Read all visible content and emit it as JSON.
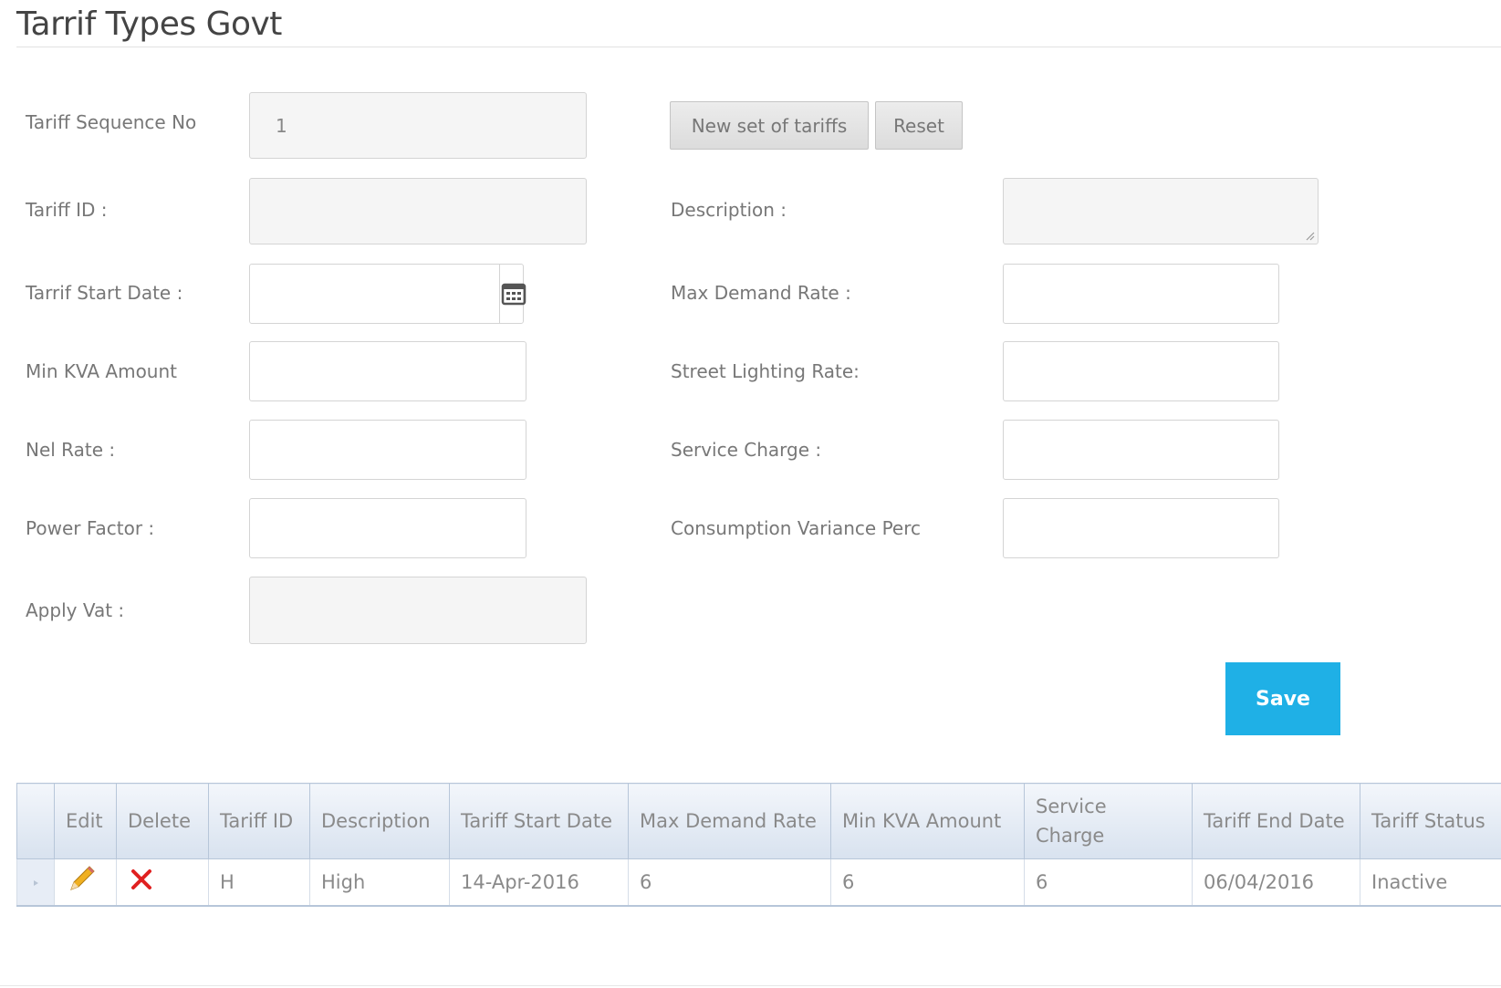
{
  "page": {
    "title": "Tarrif Types Govt"
  },
  "form": {
    "tariff_sequence_no": {
      "label": "Tariff Sequence No",
      "value": "1"
    },
    "tariff_id": {
      "label": "Tariff ID :",
      "value": ""
    },
    "tariff_start_date": {
      "label": "Tarrif Start Date :",
      "value": ""
    },
    "min_kva_amount": {
      "label": "Min KVA Amount",
      "value": ""
    },
    "nel_rate": {
      "label": "Nel Rate :",
      "value": ""
    },
    "power_factor": {
      "label": "Power Factor :",
      "value": ""
    },
    "apply_vat": {
      "label": "Apply Vat :",
      "value": ""
    },
    "description": {
      "label": "Description :",
      "value": ""
    },
    "max_demand_rate": {
      "label": "Max Demand Rate :",
      "value": ""
    },
    "street_lighting_rate": {
      "label": "Street Lighting Rate:",
      "value": ""
    },
    "service_charge": {
      "label": "Service Charge :",
      "value": ""
    },
    "consumption_variance_perc": {
      "label": "Consumption Variance Perc",
      "value": ""
    }
  },
  "buttons": {
    "new_set": "New set of tariffs",
    "reset": "Reset",
    "save": "Save"
  },
  "grid": {
    "headers": [
      "Edit",
      "Delete",
      "Tariff ID",
      "Description",
      "Tariff Start Date",
      "Max Demand Rate",
      "Min KVA Amount",
      "Service Charge",
      "Tariff End Date",
      "Tariff Status"
    ],
    "rows": [
      {
        "tariff_id": "H",
        "description": "High",
        "start_date": "14-Apr-2016",
        "max_demand_rate": "6",
        "min_kva_amount": "6",
        "service_charge": "6",
        "end_date": "06/04/2016",
        "status": "Inactive"
      }
    ]
  },
  "icons": {
    "calendar": "calendar-icon",
    "edit": "pencil-icon",
    "delete": "x-icon",
    "row_indicator": "triangle-right-icon"
  },
  "colors": {
    "save_button": "#1fb0e6",
    "delete_icon": "#e02020",
    "grid_header": "#d8e2ef"
  }
}
